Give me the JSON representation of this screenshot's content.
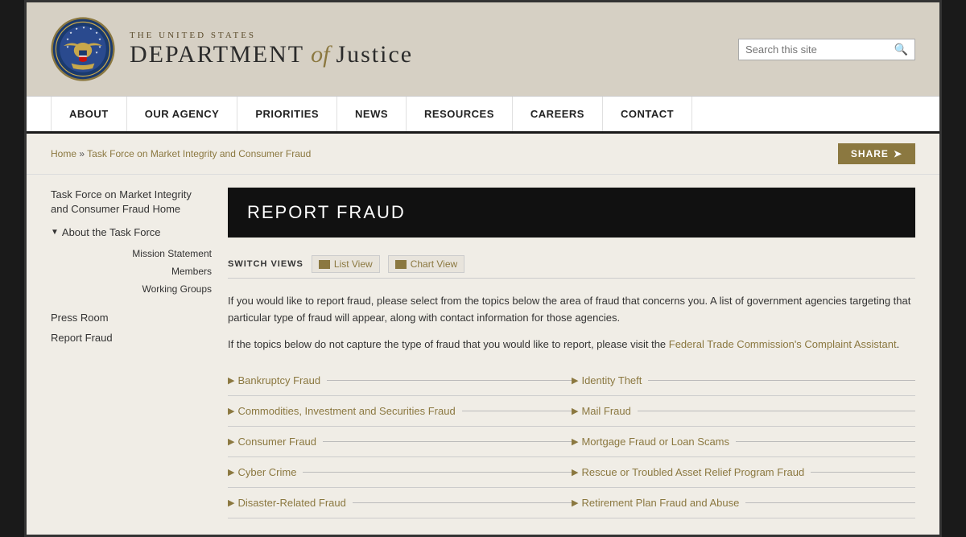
{
  "header": {
    "dept_top": "THE UNITED STATES",
    "dept_main_1": "DEPARTMENT",
    "dept_of": "of",
    "dept_main_2": "Justice",
    "search_placeholder": "Search this site"
  },
  "navbar": {
    "items": [
      "ABOUT",
      "OUR AGENCY",
      "PRIORITIES",
      "NEWS",
      "RESOURCES",
      "CAREERS",
      "CONTACT"
    ]
  },
  "breadcrumb": {
    "home": "Home",
    "separator": " » ",
    "current": "Task Force on Market Integrity and Consumer Fraud"
  },
  "share_label": "SHARE",
  "sidebar": {
    "home_link_line1": "Task Force on Market Integrity and",
    "home_link_line2": "Consumer Fraud",
    "home_link_line3": "Home",
    "about_label": "About the Task Force",
    "sub_items": [
      "Mission Statement",
      "Members",
      "Working Groups"
    ],
    "main_items": [
      "Press Room",
      "Report Fraud"
    ]
  },
  "page_title": "REPORT FRAUD",
  "switch_views": {
    "label": "SWITCH VIEWS",
    "list_view": "List View",
    "chart_view": "Chart View"
  },
  "intro_p1": "If you would like to report fraud, please select from the topics below the area of fraud that concerns you.  A list of government agencies targeting that particular type of fraud will appear, along with contact information for those agencies.",
  "intro_p2_pre": "If the topics below do not capture the type of fraud that you would like to report, please visit the ",
  "intro_p2_link": "Federal Trade Commission's Complaint Assistant",
  "intro_p2_post": ".",
  "fraud_items_left": [
    "Bankruptcy Fraud",
    "Commodities, Investment and Securities Fraud",
    "Consumer Fraud",
    "Cyber Crime",
    "Disaster-Related Fraud"
  ],
  "fraud_items_right": [
    "Identity Theft",
    "Mail Fraud",
    "Mortgage Fraud or Loan Scams",
    "Rescue or Troubled Asset Relief Program Fraud",
    "Retirement Plan Fraud and Abuse"
  ],
  "colors": {
    "gold": "#8b7840",
    "dark": "#111111",
    "bg": "#f0ede6"
  }
}
